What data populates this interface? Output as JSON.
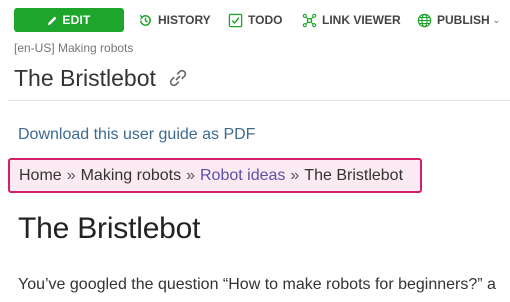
{
  "toolbar": {
    "edit_label": "EDIT",
    "history_label": "HISTORY",
    "todo_label": "TODO",
    "link_viewer_label": "LINK VIEWER",
    "publish_label": "PUBLISH",
    "edit_color": "#1ea52c",
    "icon_color": "#1ea52c"
  },
  "page": {
    "meta": "[en-US] Making robots",
    "title": "The Bristlebot"
  },
  "content": {
    "pdf_link": "Download this user guide as PDF",
    "breadcrumb": {
      "items": [
        "Home",
        "Making robots",
        "Robot ideas"
      ],
      "current": "The Bristlebot",
      "separator": "»",
      "highlight_color": "#d1216a"
    },
    "heading": "The Bristlebot",
    "intro": "You’ve googled the question “How to make robots for beginners?” a"
  }
}
